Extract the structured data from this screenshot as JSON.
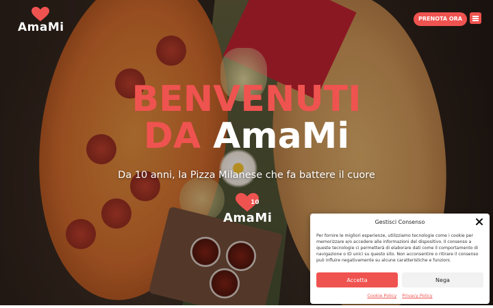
{
  "brand": {
    "name": "AmaMi",
    "accent_color": "#ef5350",
    "logo_icon": "heart-icon"
  },
  "header": {
    "cta_label": "PRENOTA ORA",
    "menu_icon": "hamburger-menu-icon"
  },
  "hero": {
    "headline_line1": "BENVENUTI",
    "headline_da": "DA",
    "headline_brand": "AmaMi",
    "subtitle": "Da 10 anni, la Pizza Milanese che fa battere il cuore",
    "badge_number": "10"
  },
  "cookie_banner": {
    "title": "Gestisci Consenso",
    "text": "Per fornire le migliori esperienze, utilizziamo tecnologie come i cookie per memorizzare e/o accedere alle informazioni del dispositivo. Il consenso a queste tecnologie ci permetterà di elaborare dati come il comportamento di navigazione o ID unici su questo sito. Non acconsentire o ritirare il consenso può influire negativamente su alcune caratteristiche e funzioni.",
    "accept_label": "Accetta",
    "deny_label": "Nega",
    "cookie_policy_label": "Cookie Policy",
    "privacy_policy_label": "Privacy Policy",
    "close_icon": "close-icon"
  }
}
